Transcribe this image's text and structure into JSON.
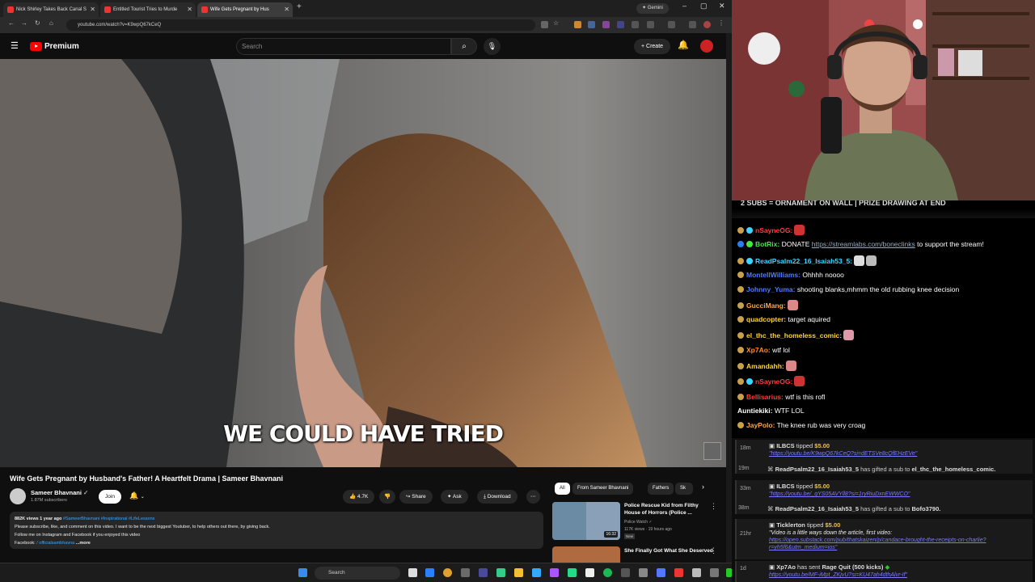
{
  "browser": {
    "tabs": [
      {
        "title": "Nick Shirley Takes Back Canal S"
      },
      {
        "title": "Entitled Tourist Tries to Murde"
      },
      {
        "title": "Wife Gets Pregnant by Hus"
      }
    ],
    "gemini_label": "Gemini",
    "url": "youtube.com/watch?v=K9wpQ67kCeQ"
  },
  "youtube": {
    "brand": "Premium",
    "search_placeholder": "Search",
    "create_label": "Create",
    "video": {
      "caption": "WE COULD HAVE TRIED",
      "title": "Wife Gets Pregnant by Husband's Father! A Heartfelt Drama | Sameer Bhavnani",
      "channel": "Sameer Bhavnani",
      "subscribers": "1.87M subscribers",
      "join_label": "Join",
      "likes": "4.7K",
      "share_label": "Share",
      "ask_label": "Ask",
      "download_label": "Download",
      "description": {
        "meta": "882K views  1 year ago",
        "tags": "#SameerBhavnani #Inspirational #LifeLessons",
        "line1": "Please subscribe, like, and comment on this video. I want to be the next biggest Youtuber, to help others out there, by giving back.",
        "line2": "Follow me on Instagram and Facebook if you enjoyed this video",
        "line3_label": "Facebook:",
        "line3_link": "/ officialsambhavna",
        "more": "...more"
      }
    },
    "chips": [
      "All",
      "From Sameer Bhavnani",
      "Fathers",
      "Sk"
    ],
    "related": [
      {
        "title": "Police Rescue Kid from Filthy House of Horrors (Police ...",
        "channel": "Police Watch",
        "views": "117K views · 19 hours ago",
        "badge": "New",
        "duration": "16:32"
      },
      {
        "title": "She Finally Got What She Deserved",
        "channel": "",
        "views": "",
        "badge": "",
        "duration": ""
      }
    ]
  },
  "taskbar": {
    "search_label": "Search"
  },
  "stream": {
    "banner": "2 SUBS = ORNAMENT ON WALL | PRIZE DRAWING AT END",
    "chat": [
      {
        "user": "nSayneOG:",
        "text": "",
        "color": "#ff3b3b"
      },
      {
        "user": "BotRix:",
        "text": " DONATE ",
        "link": "https://streamlabs.com/boneclinks",
        "after": " to support the stream!",
        "color": "#4be34b"
      },
      {
        "user": "ReadPsalm22_16_Isaiah53_5:",
        "text": "",
        "color": "#3ad6ff"
      },
      {
        "user": "MontellWilliams:",
        "text": " Ohhhh noooo",
        "color": "#4d7dff"
      },
      {
        "user": "Johnny_Yuma:",
        "text": " shooting blanks,mhmm the old rubbing knee decision",
        "color": "#4d7dff"
      },
      {
        "user": "GucciMang:",
        "text": "",
        "color": "#ffa640"
      },
      {
        "user": "quadcopter:",
        "text": " target aquired",
        "color": "#ffd23a"
      },
      {
        "user": "el_thc_the_homeless_comic:",
        "text": "",
        "color": "#ffd23a"
      },
      {
        "user": "Xp7Ao:",
        "text": " wtf lol",
        "color": "#ff8c2a"
      },
      {
        "user": "Amandahh:",
        "text": "",
        "color": "#ffd23a"
      },
      {
        "user": "nSayneOG:",
        "text": "",
        "color": "#ff3b3b"
      },
      {
        "user": "Bellisarius:",
        "text": " wtf is this rofl",
        "color": "#ff3b3b"
      },
      {
        "user": "Auntiekiki:",
        "text": " WTF LOL",
        "color": "#ffffff"
      },
      {
        "user": "JayPolo:",
        "text": " The knee rub was very croag",
        "color": "#ffa640"
      }
    ],
    "events": [
      {
        "time": "18m",
        "user": "ILBCS",
        "action": " tipped ",
        "amount": "$5.00",
        "msg": "\"https://youtu.be/K9wpQ67kCeQ?si=dETSVe8cQfEHzEVe\""
      },
      {
        "time": "19m",
        "user": "ReadPsalm22_16_Isaiah53_5",
        "action": " has gifted a sub to ",
        "target": "el_thc_the_homeless_comic."
      },
      {
        "time": "33m",
        "user": "ILBCS",
        "action": " tipped ",
        "amount": "$5.00",
        "msg": "\"https://youtu.be/_qYS05AVYll8?si=1ryRiuDxnEWWCO\""
      },
      {
        "time": "38m",
        "user": "ReadPsalm22_16_Isaiah53_5",
        "action": " has gifted a sub to ",
        "target": "Bofo3790."
      },
      {
        "time": "21hr",
        "user": "Ticklerton",
        "action": " tipped ",
        "amount": "$5.00",
        "msg": "\"Video is a little ways down the article, first video:",
        "msg2": "https://open.substack.com/pub/thatskaizen/p/candace-brought-the-receipts-on-charlie?",
        "msg3": "r=yh5f6&utm_medium=ios\""
      },
      {
        "time": "1d",
        "user": "Xp7Ao",
        "action": " has sent ",
        "target": "Rage Quit (500 kicks)",
        "msg": "https://youtu.be/MF-iMpt_ZKjvU?si=KU47ah4dthAlvr-If\""
      }
    ]
  }
}
